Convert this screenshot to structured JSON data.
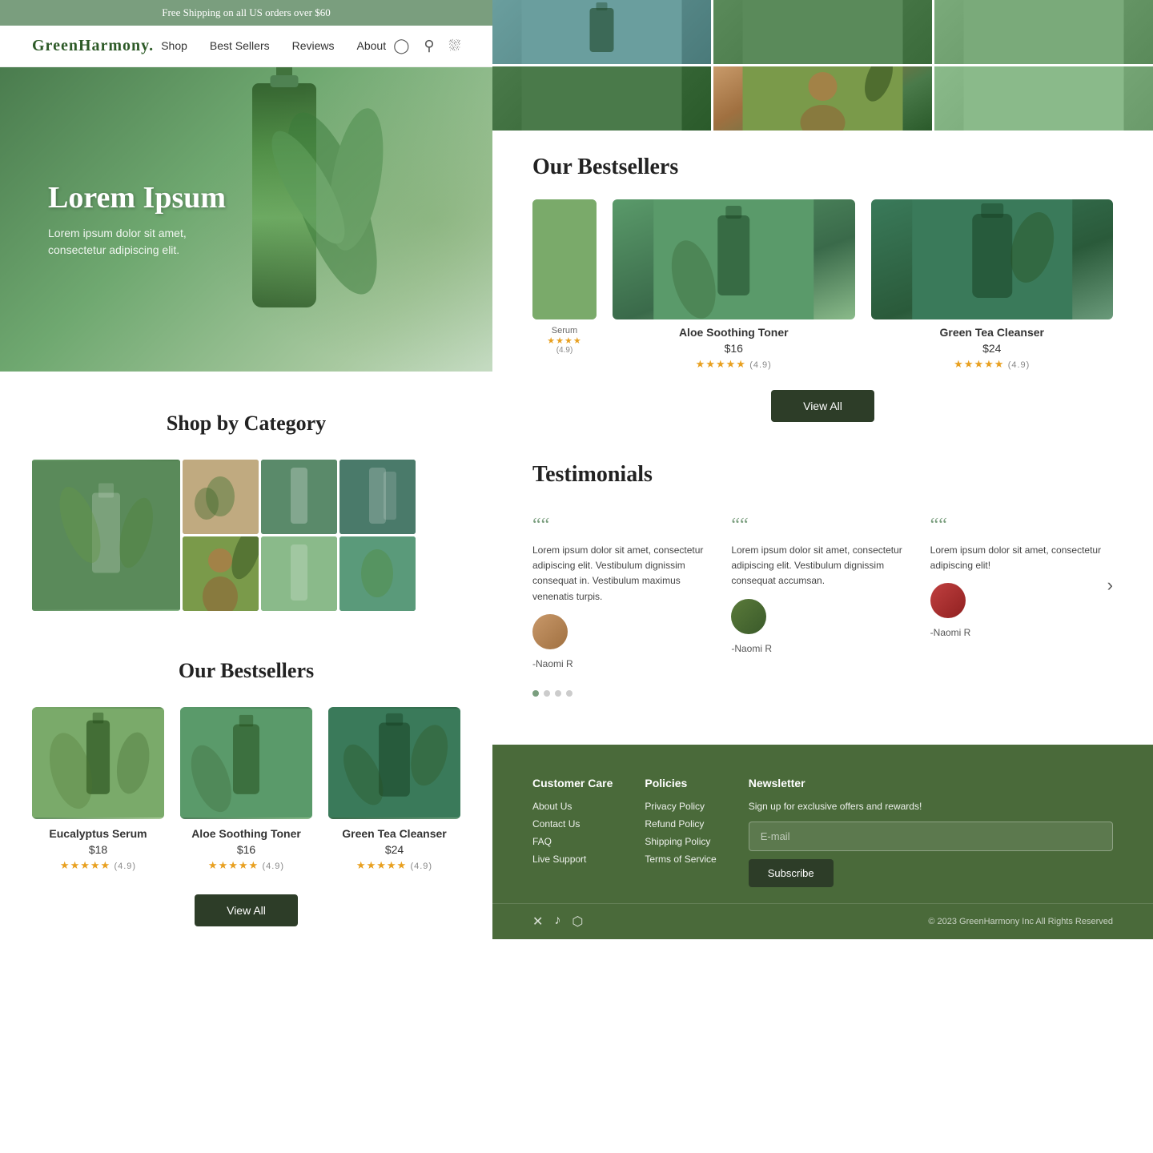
{
  "site": {
    "name": "GreenHarmony.",
    "announcement": "Free Shipping on all US orders over $60"
  },
  "nav": {
    "items": [
      {
        "label": "Shop"
      },
      {
        "label": "Best Sellers"
      },
      {
        "label": "Reviews"
      },
      {
        "label": "About"
      }
    ]
  },
  "hero": {
    "heading": "Lorem Ipsum",
    "subtext": "Lorem ipsum dolor sit amet, consectetur adipiscing elit."
  },
  "category_section": {
    "title": "Shop by Category"
  },
  "bestsellers_section": {
    "title": "Our Bestsellers",
    "products": [
      {
        "name": "Eucalyptus Serum",
        "price": "$18",
        "stars": "★★★★★",
        "rating": "(4.9)"
      },
      {
        "name": "Aloe Soothing Toner",
        "price": "$16",
        "stars": "★★★★★",
        "rating": "(4.9)"
      },
      {
        "name": "Green Tea Cleanser",
        "price": "$24",
        "stars": "★★★★★",
        "rating": "(4.9)"
      }
    ],
    "view_all_label": "View All"
  },
  "testimonials_section": {
    "title": "Testimonials",
    "items": [
      {
        "text": "Lorem ipsum dolor sit amet, consectetur adipiscing elit. Vestibulum dignissim consequat in. Vestibulum maximus venenatis turpis.",
        "author": "-Naomi R"
      },
      {
        "text": "Lorem ipsum dolor sit amet, consectetur adipiscing elit. Vestibulum dignissim consequat accumsan.",
        "author": "-Naomi R"
      },
      {
        "text": "Lorem ipsum dolor sit amet, consectetur adipiscing elit!",
        "author": "-Naomi R"
      }
    ]
  },
  "footer": {
    "columns": {
      "customer_care": {
        "title": "Customer Care",
        "items": [
          "About Us",
          "Contact Us",
          "FAQ",
          "Live Support"
        ]
      },
      "policies": {
        "title": "Policies",
        "items": [
          "Privacy Policy",
          "Refund Policy",
          "Shipping Policy",
          "Terms of Service"
        ]
      },
      "newsletter": {
        "title": "Newsletter",
        "description": "Sign up for exclusive offers and rewards!",
        "placeholder": "E-mail",
        "button_label": "Subscribe"
      }
    },
    "copyright": "© 2023 GreenHarmony Inc All Rights Reserved"
  }
}
